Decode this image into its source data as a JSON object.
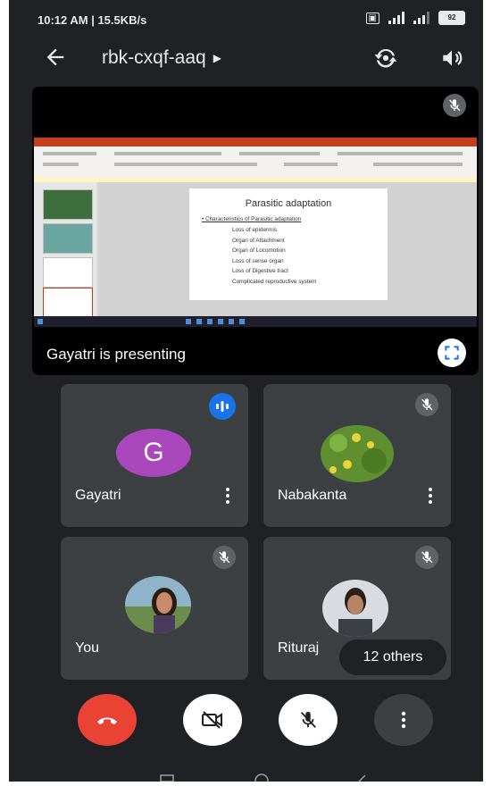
{
  "status_bar": {
    "time": "10:12 AM | 15.5KB/s",
    "battery": "92"
  },
  "header": {
    "meeting_code": "rbk-cxqf-aaq"
  },
  "presentation": {
    "label": "Gayatri is presenting",
    "slide": {
      "title": "Parasitic adaptation",
      "heading": "Characteristics of Parasitic adaptation",
      "items": [
        "Loss of epidermis",
        "Organ of Attachment",
        "Organ of Locomotion",
        "Loss of sense organ",
        "Loss of Digestive tract",
        "Complicated reproductive system"
      ]
    }
  },
  "participants": [
    {
      "name": "Gayatri",
      "avatar_letter": "G",
      "speaking": true
    },
    {
      "name": "Nabakanta",
      "muted": true
    },
    {
      "name": "You",
      "muted": true
    },
    {
      "name": "Rituraj",
      "muted": true
    }
  ],
  "others_label": "12 others",
  "colors": {
    "background": "#202124",
    "tile": "#3c4043",
    "end_call": "#ea4335",
    "speaking": "#1a73e8",
    "avatar": "#ab47bc"
  }
}
